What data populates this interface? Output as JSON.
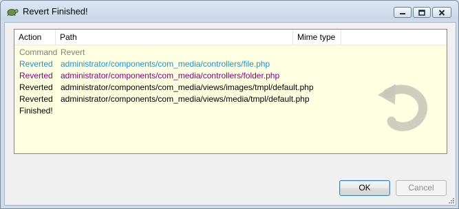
{
  "window": {
    "title": "Revert Finished!"
  },
  "columns": [
    {
      "label": "Action"
    },
    {
      "label": "Path"
    },
    {
      "label": "Mime type"
    }
  ],
  "rows": [
    {
      "action": "Command",
      "path": "Revert",
      "color": "#808080"
    },
    {
      "action": "Reverted",
      "path": "administrator/components/com_media/controllers/file.php",
      "color": "#1e8fd1"
    },
    {
      "action": "Reverted",
      "path": "administrator/components/com_media/controllers/folder.php",
      "color": "#800080"
    },
    {
      "action": "Reverted",
      "path": "administrator/components/com_media/views/images/tmpl/default.php",
      "color": "#000000"
    },
    {
      "action": "Reverted",
      "path": "administrator/components/com_media/views/media/tmpl/default.php",
      "color": "#000000"
    },
    {
      "action": "Finished!",
      "path": "",
      "color": "#000000"
    }
  ],
  "buttons": {
    "ok": "OK",
    "cancel": "Cancel"
  },
  "icons": {
    "app": "tortoise-svn-icon",
    "minimize": "minimize-icon",
    "maximize": "maximize-icon",
    "close": "close-icon",
    "watermark": "revert-arrow-icon"
  }
}
